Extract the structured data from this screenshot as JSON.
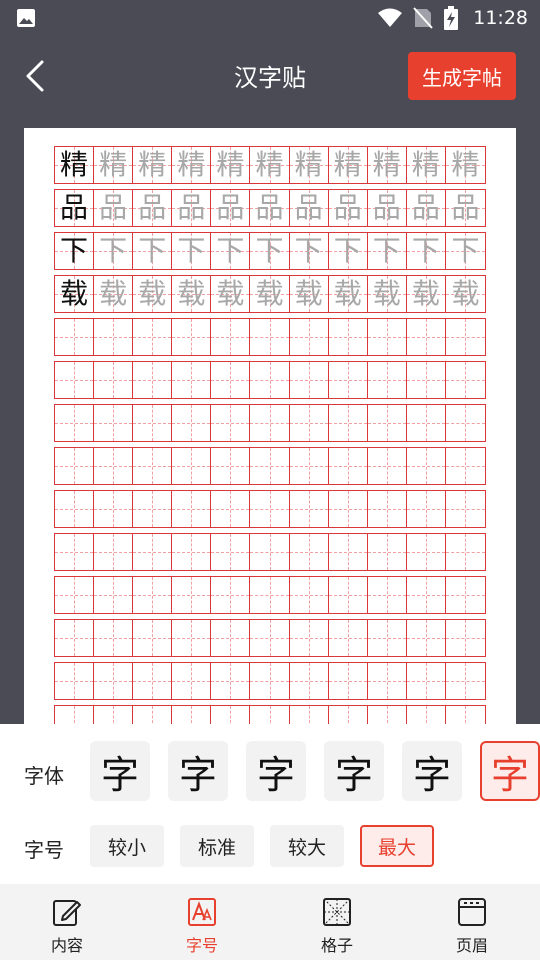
{
  "status_bar": {
    "time": "11:28"
  },
  "header": {
    "title": "汉字贴",
    "generate_label": "生成字帖"
  },
  "practice_sheet": {
    "rows": [
      {
        "char": "精"
      },
      {
        "char": "品"
      },
      {
        "char": "下"
      },
      {
        "char": "载"
      },
      {
        "char": ""
      },
      {
        "char": ""
      },
      {
        "char": ""
      },
      {
        "char": ""
      },
      {
        "char": ""
      },
      {
        "char": ""
      },
      {
        "char": ""
      },
      {
        "char": ""
      },
      {
        "char": ""
      },
      {
        "char": ""
      }
    ],
    "columns": 11,
    "grid_color": "#d9383a",
    "trace_color": "#a8a8a8"
  },
  "settings": {
    "font_label": "字体",
    "font_options": [
      "字",
      "字",
      "字",
      "字",
      "字",
      "字"
    ],
    "font_selected_index": 5,
    "size_label": "字号",
    "size_options": [
      "较小",
      "标准",
      "较大",
      "最大"
    ],
    "size_selected_index": 3
  },
  "bottom_nav": {
    "items": [
      {
        "label": "内容",
        "icon": "edit-icon"
      },
      {
        "label": "字号",
        "icon": "font-size-icon"
      },
      {
        "label": "格子",
        "icon": "grid-icon"
      },
      {
        "label": "页眉",
        "icon": "page-header-icon"
      }
    ],
    "active_index": 1
  },
  "colors": {
    "accent": "#e8402f",
    "toolbar": "#4a4b55"
  }
}
